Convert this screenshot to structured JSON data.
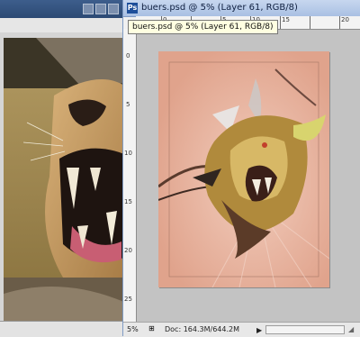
{
  "window": {
    "title": "buers.psd @ 5% (Layer 61, RGB/8)",
    "app_icon": "Ps",
    "tooltip": "buers.psd @ 5% (Layer 61, RGB/8)"
  },
  "rulers": {
    "horizontal_labels": [
      "0",
      "5",
      "10",
      "15",
      "20"
    ],
    "vertical_labels": [
      "0",
      "5",
      "10",
      "15",
      "20",
      "25"
    ]
  },
  "status": {
    "zoom": "5%",
    "doc_info": "Doc: 164.3M/644.2M",
    "arrow": "▶"
  },
  "icons": {
    "app": "photoshop-icon",
    "status_menu": "triangle-right-icon",
    "scroll_left": "scroll-left-icon"
  },
  "colors": {
    "title_active": "#b7cbe9",
    "artboard": "#e2a993",
    "tooltip_bg": "#ffffe1"
  }
}
